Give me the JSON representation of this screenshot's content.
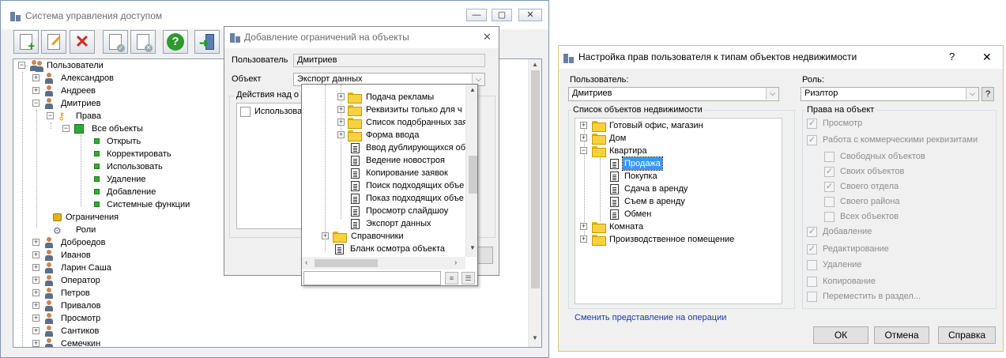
{
  "win1": {
    "title": "Система управления доступом",
    "min": "—",
    "max": "▢",
    "close": "✕",
    "tree": {
      "root": "Пользователи",
      "users_before": [
        "Александров",
        "Андреев"
      ],
      "expanded_user": "Дмитриев",
      "rights": "Права",
      "all_objects": "Все объекты",
      "perms": [
        "Открыть",
        "Корректировать",
        "Использовать",
        "Удаление",
        "Добавление",
        "Системные функции"
      ],
      "limits": "Ограничения",
      "roles": "Роли",
      "users_after": [
        "Доброедов",
        "Иванов",
        "Ларин Саша",
        "Оператор",
        "Петров",
        "Привалов",
        "Просмотр",
        "Сантиков",
        "Семечкин"
      ]
    }
  },
  "win2": {
    "title": "Добавление ограничений на объекты",
    "user_label": "Пользователь",
    "user_value": "Дмитриев",
    "object_label": "Объект",
    "object_value": "Экспорт данных",
    "actions_group": "Действия над о",
    "use_label": "Использова",
    "close": "✕"
  },
  "dropdown": {
    "folders_top": [
      "Подача рекламы",
      "Реквизиты только для ч",
      "Список подобранных зая",
      "Форма ввода"
    ],
    "docs": [
      "Ввод дублирующихся об",
      "Ведение новостроя",
      "Копирование заявок",
      "Поиск подходящих объе",
      "Показ подходящих объе",
      "Просмотр слайдшоу",
      "Экспорт данных"
    ],
    "folder_ref": "Справочники",
    "doc_form": "Бланк осмотра объекта"
  },
  "win3": {
    "title": "Настройка прав пользователя к типам объектов недвижимости",
    "help": "?",
    "close": "✕",
    "user_label": "Пользователь:",
    "user_value": "Дмитриев",
    "role_label": "Роль:",
    "role_value": "Риэлтор",
    "role_help": "?",
    "list_title": "Список объектов недвижимости",
    "objects": {
      "top": [
        "Готовый офис, магазин",
        "Дом"
      ],
      "apartment": "Квартира",
      "apartment_children": [
        "Продажа",
        "Покупка",
        "Сдача в аренду",
        "Съем в аренду",
        "Обмен"
      ],
      "bottom": [
        "Комната",
        "Производственное помещение"
      ]
    },
    "rights_title": "Права на объект",
    "rights": {
      "view": "Просмотр",
      "commercial": "Работа с коммерческими реквизитами",
      "free": "Свободных объектов",
      "own": "Своих объектов",
      "dept": "Своего отдела",
      "region": "Своего района",
      "all": "Всех объектов",
      "add": "Добавление",
      "edit": "Редактирование",
      "delete": "Удаление",
      "copy": "Копирование",
      "move": "Переместить в раздел..."
    },
    "link": "Сменить представление на операции",
    "ok": "ОК",
    "cancel": "Отмена",
    "helpbtn": "Справка"
  }
}
